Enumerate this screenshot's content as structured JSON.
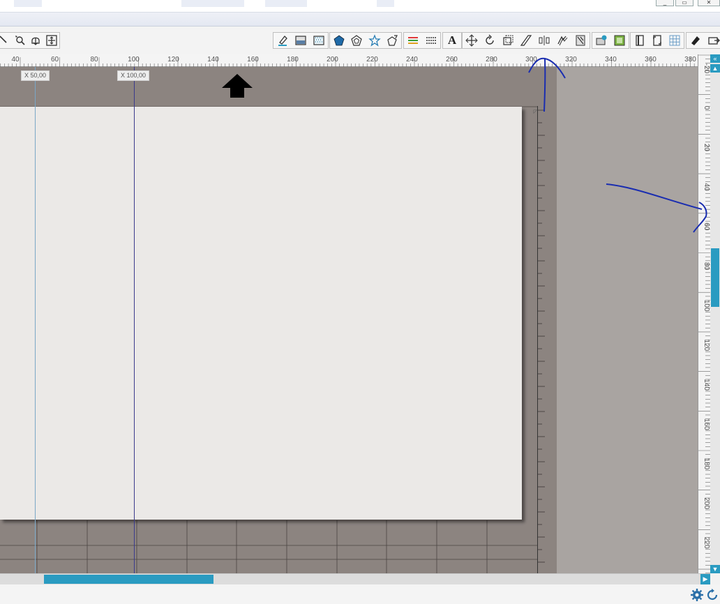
{
  "window": {
    "restore_glyph": "▭",
    "close_glyph": "✕"
  },
  "toolbar": {
    "groups": [
      {
        "name": "group-edit",
        "items": [
          "zoom-select-icon",
          "pan-icon",
          "fit-to-page-icon"
        ]
      },
      {
        "name": "group-fill",
        "items": [
          "line-color-icon",
          "fill-color-icon",
          "fill-pattern-icon"
        ]
      },
      {
        "name": "group-shapes",
        "items": [
          "polygon-icon",
          "offset-icon",
          "star-icon",
          "knife-icon"
        ]
      },
      {
        "name": "group-line",
        "items": [
          "line-style-icon",
          "dash-style-icon"
        ]
      },
      {
        "name": "group-text",
        "items": [
          "text-style-icon"
        ]
      },
      {
        "name": "group-transform",
        "items": [
          "transform-icon",
          "rotate-icon",
          "scale-icon",
          "shear-icon",
          "align-icon",
          "replicate-icon",
          "modify-icon"
        ]
      },
      {
        "name": "group-image",
        "items": [
          "image-effects-icon",
          "trace-icon"
        ]
      },
      {
        "name": "group-page",
        "items": [
          "page-setup-icon",
          "registration-marks-icon",
          "grid-icon"
        ]
      },
      {
        "name": "group-cut",
        "items": [
          "cut-style-icon",
          "send-to-icon"
        ]
      }
    ],
    "text_button_label": "A"
  },
  "ruler_top": {
    "ticks": [
      "40",
      "60",
      "80",
      "100",
      "120",
      "140",
      "160",
      "180",
      "200",
      "220",
      "240",
      "260",
      "280",
      "300",
      "320",
      "340",
      "360",
      "380"
    ]
  },
  "ruler_right": {
    "ticks": [
      "-20",
      "0",
      "20",
      "40",
      "60",
      "80",
      "100",
      "120",
      "140",
      "160",
      "180",
      "200",
      "220"
    ]
  },
  "guides": [
    {
      "label": "X  50,00",
      "color": "#7aa7c7"
    },
    {
      "label": "X  100,00",
      "color": "#3a3a8c"
    }
  ],
  "scrollbars": {
    "up_arrow": "▲",
    "down_arrow": "▼",
    "collapse": "«",
    "right_arrow": "▶"
  },
  "colors": {
    "accent": "#2a9bc1",
    "mat": "#8c8480",
    "paper": "#ebe9e7",
    "workspace": "#a9a4a1",
    "annotation_ink": "#1a2db0"
  }
}
